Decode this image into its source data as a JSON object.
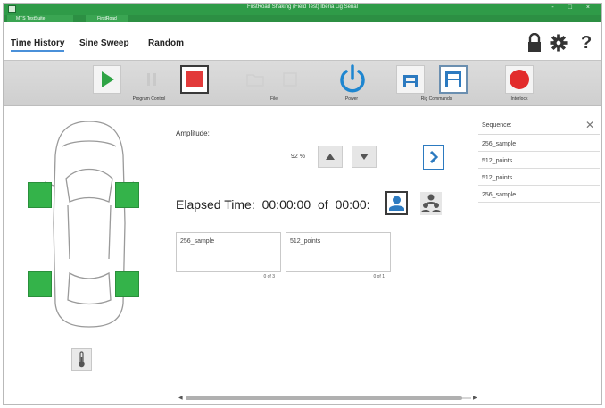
{
  "window": {
    "title": "FirstRoad Shaking (Field Test) Iberia Lig Serial",
    "brand": "MTS TestSuite",
    "product": "FirstRoad",
    "controls": [
      "-",
      "□",
      "×"
    ]
  },
  "nav": {
    "tabs": [
      {
        "label": "Time History",
        "active": true
      },
      {
        "label": "Sine Sweep",
        "active": false
      },
      {
        "label": "Random",
        "active": false
      }
    ],
    "icons": [
      "lock-icon",
      "gear-icon",
      "help-icon"
    ],
    "help_label": "?"
  },
  "toolbar": {
    "groups": [
      {
        "label": "Program Control"
      },
      {
        "label": "File"
      },
      {
        "label": "Power"
      },
      {
        "label": "Rig Commands"
      },
      {
        "label": "Interlock"
      }
    ],
    "colors": {
      "play": "#2fa445",
      "stop": "#e23a3a",
      "power": "#1e86d0",
      "interlock": "#e22b2b",
      "rig": "#2c7ac0"
    }
  },
  "amplitude": {
    "label": "Amplitude:",
    "value": "92 %"
  },
  "elapsed": {
    "label": "Elapsed Time:",
    "time": "00:00:00",
    "of": "of",
    "total": "00:00:"
  },
  "sequence_cards": [
    {
      "name": "256_sample",
      "count": "0 of 3"
    },
    {
      "name": "512_points",
      "count": "0 of 1"
    }
  ],
  "sequence": {
    "label": "Sequence:",
    "items": [
      "256_sample",
      "512_points",
      "512_points",
      "256_sample"
    ]
  },
  "tire_color": "#34b34a"
}
